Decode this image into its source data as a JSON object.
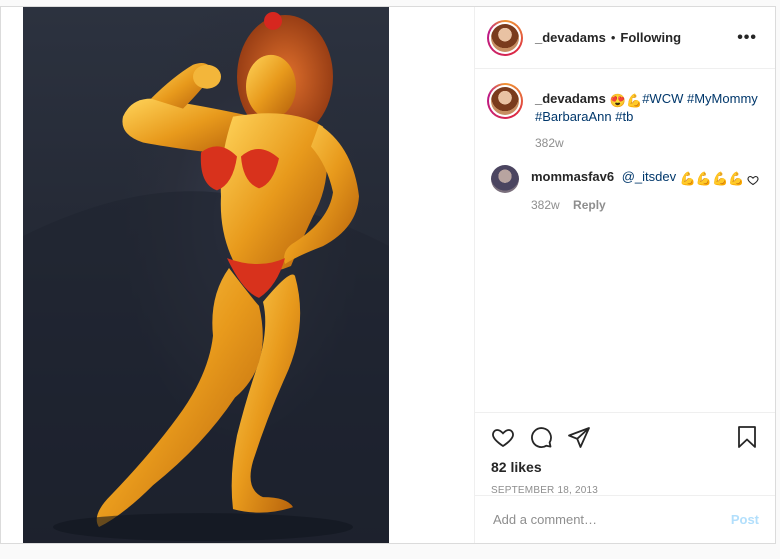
{
  "post": {
    "author": "_devadams",
    "follow_separator": "•",
    "follow_status": "Following",
    "more_label": "•••",
    "image_description": "Bodybuilder woman in red bikini posing"
  },
  "caption": {
    "username": "_devadams",
    "emoji": "😍💪",
    "tags": [
      "#WCW",
      "#MyMommy",
      "#BarbaraAnn",
      "#tb"
    ],
    "time": "382w"
  },
  "comments": [
    {
      "username": "mommasfav6",
      "mention": "@_itsdev",
      "emoji": "💪💪💪💪",
      "time": "382w",
      "reply_label": "Reply"
    }
  ],
  "stats": {
    "likes": "82 likes",
    "date": "SEPTEMBER 18, 2013"
  },
  "composer": {
    "placeholder": "Add a comment…",
    "post_label": "Post"
  },
  "colors": {
    "link": "#00376b",
    "post_disabled": "#b2dffc",
    "muted": "#8e8e8e"
  },
  "icons": [
    "heart-icon",
    "comment-icon",
    "share-icon",
    "bookmark-icon",
    "more-options-icon"
  ]
}
